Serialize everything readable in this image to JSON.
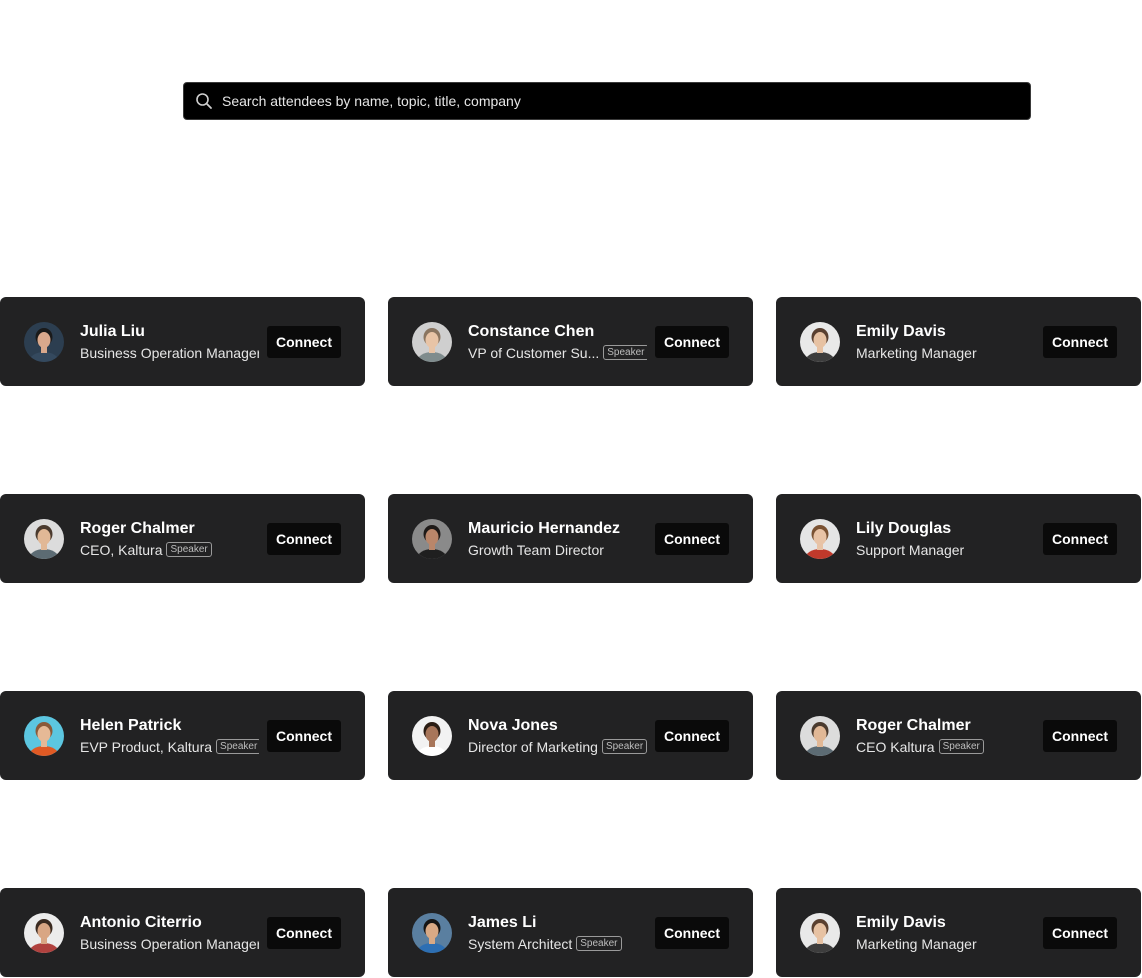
{
  "search": {
    "placeholder": "Search attendees by name, topic, title, company"
  },
  "attendees": [
    {
      "name": "Julia Liu",
      "title": "Business Operation Manager",
      "speaker_badge": "",
      "avatar_icon": "person-avatar",
      "avatar_bg": "#2c3e50",
      "skin": "#d9a88c",
      "hair": "#1a1a1a",
      "shirt": "#34495e"
    },
    {
      "name": "Constance Chen",
      "title": "VP of Customer Su...",
      "speaker_badge": "Speaker",
      "avatar_icon": "person-avatar",
      "avatar_bg": "#cfcfcf",
      "skin": "#e8c4a6",
      "hair": "#8a7560",
      "shirt": "#7f8c8d"
    },
    {
      "name": "Emily Davis",
      "title": "Marketing Manager",
      "speaker_badge": "",
      "avatar_icon": "person-avatar",
      "avatar_bg": "#e9e9e9",
      "skin": "#e7c2a3",
      "hair": "#5a4030",
      "shirt": "#3d3d3d"
    },
    {
      "name": "Roger Chalmer",
      "title": "CEO, Kaltura",
      "speaker_badge": "Speaker",
      "avatar_icon": "person-avatar",
      "avatar_bg": "#dcdcdc",
      "skin": "#e1b896",
      "hair": "#4a3a2e",
      "shirt": "#5c6b73"
    },
    {
      "name": "Mauricio Hernandez",
      "title": "Growth Team Director",
      "speaker_badge": "",
      "avatar_icon": "person-avatar",
      "avatar_bg": "#8a8a8a",
      "skin": "#b9866a",
      "hair": "#1e1a18",
      "shirt": "#1f1f1f"
    },
    {
      "name": "Lily Douglas",
      "title": "Support Manager",
      "speaker_badge": "",
      "avatar_icon": "person-avatar",
      "avatar_bg": "#e5e5e5",
      "skin": "#e8c3a6",
      "hair": "#7a5233",
      "shirt": "#c0392b"
    },
    {
      "name": "Helen Patrick",
      "title": "EVP Product, Kaltura",
      "speaker_badge": "Speaker",
      "avatar_icon": "person-avatar",
      "avatar_bg": "#5cc6e0",
      "skin": "#e6b996",
      "hair": "#8a5a3a",
      "shirt": "#e05a24"
    },
    {
      "name": "Nova Jones",
      "title": "Director of Marketing",
      "speaker_badge": "Speaker",
      "avatar_icon": "person-avatar",
      "avatar_bg": "#f2f2f2",
      "skin": "#a8765a",
      "hair": "#2b1d14",
      "shirt": "#ffffff"
    },
    {
      "name": "Roger Chalmer",
      "title": "CEO Kaltura",
      "speaker_badge": "Speaker",
      "avatar_icon": "person-avatar",
      "avatar_bg": "#dcdcdc",
      "skin": "#e1b896",
      "hair": "#4a3a2e",
      "shirt": "#5c6b73"
    },
    {
      "name": "Antonio Citerrio",
      "title": "Business Operation Manager",
      "speaker_badge": "",
      "avatar_icon": "person-avatar",
      "avatar_bg": "#ececec",
      "skin": "#d9a684",
      "hair": "#3a2a20",
      "shirt": "#b0413e"
    },
    {
      "name": "James Li",
      "title": "System Architect",
      "speaker_badge": "Speaker",
      "avatar_icon": "person-avatar",
      "avatar_bg": "#5a7fa0",
      "skin": "#d8a985",
      "hair": "#151515",
      "shirt": "#2d6fb3"
    },
    {
      "name": "Emily Davis",
      "title": "Marketing Manager",
      "speaker_badge": "",
      "avatar_icon": "person-avatar",
      "avatar_bg": "#e9e9e9",
      "skin": "#e7c2a3",
      "hair": "#5a4030",
      "shirt": "#3d3d3d"
    }
  ],
  "connect_label": "Connect",
  "colors": {
    "page_bg": "#ffffff",
    "card_bg": "#222223",
    "button_bg": "#0a0a0a",
    "search_bg": "#000000"
  }
}
